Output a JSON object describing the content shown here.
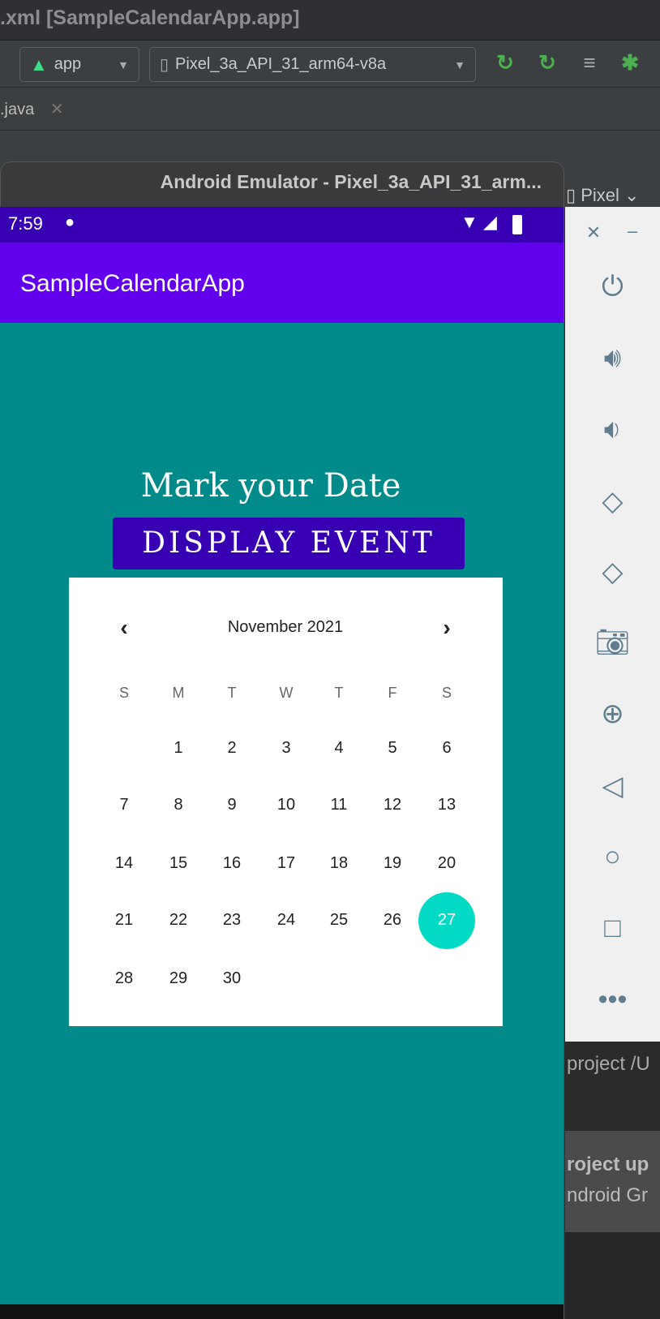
{
  "ide": {
    "title": ".xml [SampleCalendarApp.app]",
    "run_config": "app",
    "device": "Pixel_3a_API_31_arm64-v8a",
    "tab": ".java",
    "pixel_label": "Pixel",
    "log_text": "project /U",
    "notif_title": "roject up",
    "notif_body": "ndroid Gr"
  },
  "emulator": {
    "title": "Android Emulator - Pixel_3a_API_31_arm..."
  },
  "phone": {
    "time": "7:59",
    "app_title": "SampleCalendarApp",
    "heading": "Mark your Date",
    "button": "DISPLAY EVENT"
  },
  "calendar": {
    "month": "November 2021",
    "weekdays": [
      "S",
      "M",
      "T",
      "W",
      "T",
      "F",
      "S"
    ],
    "first_weekday_index": 1,
    "days_in_month": 30,
    "selected_day": 27
  },
  "colors": {
    "status": "#3700b3",
    "appbar": "#6200ee",
    "bg": "#008b8a",
    "selected": "#03dac5"
  }
}
